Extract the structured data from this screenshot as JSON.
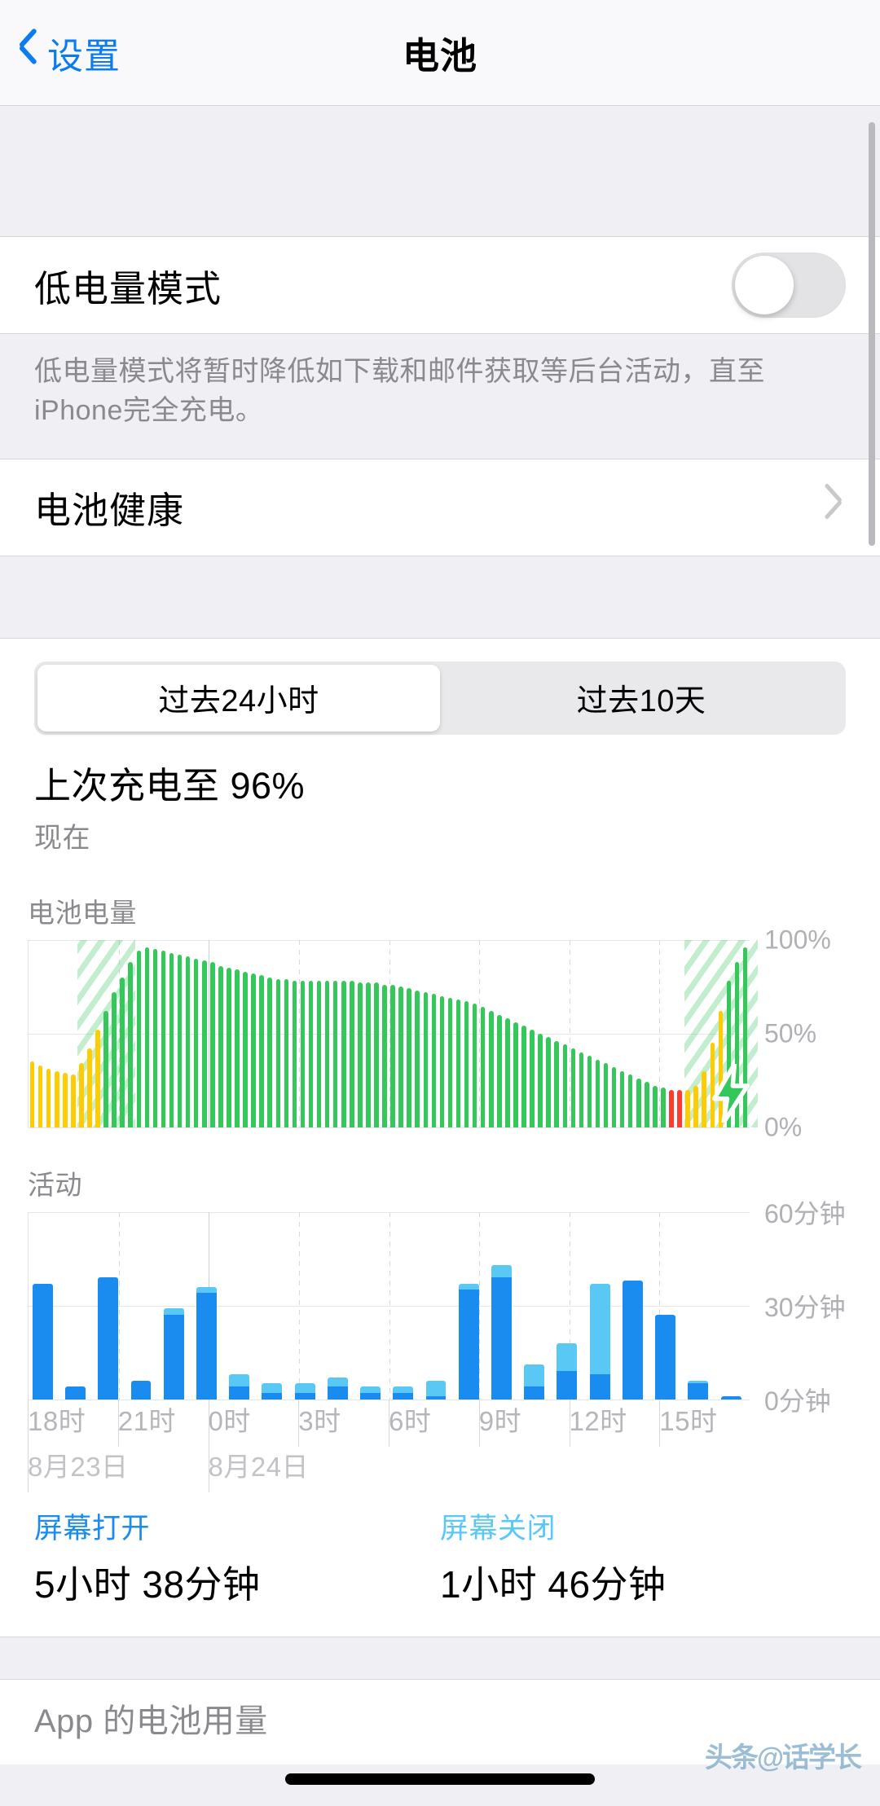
{
  "nav": {
    "back_label": "设置",
    "title": "电池",
    "back_icon": "chevron-left-icon"
  },
  "low_power": {
    "label": "低电量模式",
    "toggle_state": "off",
    "footnote": "低电量模式将暂时降低如下载和邮件获取等后台活动，直至 iPhone完全充电。"
  },
  "battery_health": {
    "label": "电池健康",
    "disclosure_icon": "chevron-right-icon"
  },
  "segmented": {
    "options": [
      "过去24小时",
      "过去10天"
    ],
    "selected_index": 0
  },
  "last_charge": {
    "title": "上次充电至 96%",
    "subtitle": "现在",
    "percent": 96
  },
  "usage": {
    "screen_on_label": "屏幕打开",
    "screen_on_value": "5小时 38分钟",
    "screen_off_label": "屏幕关闭",
    "screen_off_value": "1小时 46分钟"
  },
  "app_usage": {
    "label": "App 的电池用量"
  },
  "watermark": {
    "text": "头条@话学长"
  },
  "colors": {
    "accent_blue": "#0a7cf0",
    "battery_green": "#34c759",
    "battery_yellow": "#ffcc00",
    "battery_red": "#ff3b30",
    "screen_on_blue": "#1a8cf0",
    "screen_off_blue": "#5ac8f5",
    "gray_text": "#8a8a8e"
  },
  "chart_data": [
    {
      "type": "bar",
      "id": "battery-level",
      "title": "电池电量",
      "ylabel": "",
      "xlabel": "",
      "ylim": [
        0,
        100
      ],
      "yticks": [
        0,
        50,
        100
      ],
      "ytick_labels": [
        "0%",
        "50%",
        "100%"
      ],
      "grid": true,
      "legend": "none",
      "series": [
        {
          "name": "电池电量",
          "values": [
            35,
            33,
            31,
            30,
            29,
            28,
            34,
            42,
            52,
            62,
            72,
            80,
            88,
            94,
            96,
            95,
            94,
            93,
            92,
            91,
            90,
            89,
            88,
            86,
            85,
            84,
            83,
            82,
            81,
            80,
            79,
            79,
            78,
            78,
            78,
            78,
            78,
            78,
            78,
            78,
            77,
            77,
            77,
            76,
            76,
            75,
            74,
            73,
            72,
            71,
            70,
            69,
            68,
            67,
            66,
            64,
            62,
            60,
            58,
            56,
            54,
            52,
            50,
            48,
            46,
            44,
            42,
            40,
            38,
            36,
            34,
            32,
            30,
            28,
            26,
            24,
            22,
            21,
            20,
            20,
            20,
            22,
            30,
            45,
            62,
            78,
            88,
            96
          ],
          "colors": [
            "yellow",
            "yellow",
            "yellow",
            "yellow",
            "yellow",
            "yellow",
            "yellow",
            "yellow",
            "yellow",
            "green",
            "green",
            "green",
            "green",
            "green",
            "green",
            "green",
            "green",
            "green",
            "green",
            "green",
            "green",
            "green",
            "green",
            "green",
            "green",
            "green",
            "green",
            "green",
            "green",
            "green",
            "green",
            "green",
            "green",
            "green",
            "green",
            "green",
            "green",
            "green",
            "green",
            "green",
            "green",
            "green",
            "green",
            "green",
            "green",
            "green",
            "green",
            "green",
            "green",
            "green",
            "green",
            "green",
            "green",
            "green",
            "green",
            "green",
            "green",
            "green",
            "green",
            "green",
            "green",
            "green",
            "green",
            "green",
            "green",
            "green",
            "green",
            "green",
            "green",
            "green",
            "green",
            "green",
            "green",
            "green",
            "green",
            "green",
            "green",
            "green",
            "red",
            "red",
            "yellow",
            "yellow",
            "yellow",
            "yellow",
            "yellow",
            "green",
            "green",
            "green"
          ]
        }
      ],
      "charging_regions": [
        {
          "start_index": 6,
          "end_index": 12,
          "label": "charging"
        },
        {
          "start_index": 80,
          "end_index": 88,
          "label": "charging"
        }
      ],
      "annotations": [
        {
          "icon": "lightning-bolt-icon",
          "index": 83
        }
      ]
    },
    {
      "type": "bar",
      "id": "activity",
      "title": "活动",
      "ylabel": "",
      "xlabel": "",
      "ylim": [
        0,
        60
      ],
      "yticks": [
        0,
        30,
        60
      ],
      "ytick_labels": [
        "0分钟",
        "30分钟",
        "60分钟"
      ],
      "grid": true,
      "stacked": true,
      "categories": [
        "18时",
        "21时",
        "0时",
        "3时",
        "6时",
        "9时",
        "12时",
        "15时"
      ],
      "date_labels": [
        "8月23日",
        "8月24日"
      ],
      "legend_entries": [
        {
          "name": "屏幕打开",
          "color": "#1a8cf0"
        },
        {
          "name": "屏幕关闭",
          "color": "#5ac8f5"
        }
      ],
      "series": [
        {
          "name": "屏幕打开",
          "values": [
            37,
            4,
            39,
            6,
            27,
            34,
            4,
            2,
            2,
            4,
            2,
            2,
            1,
            35,
            39,
            4,
            9,
            8,
            38,
            27,
            5,
            1
          ]
        },
        {
          "name": "屏幕关闭",
          "values": [
            0,
            0,
            0,
            0,
            2,
            2,
            4,
            3,
            3,
            3,
            2,
            2,
            5,
            2,
            4,
            7,
            9,
            29,
            0,
            0,
            1,
            0
          ]
        }
      ]
    }
  ]
}
